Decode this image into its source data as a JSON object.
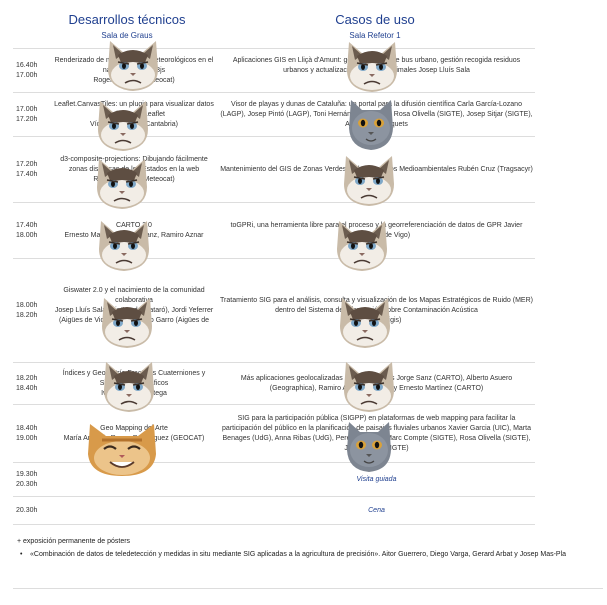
{
  "headers": {
    "left_title": "Desarrollos técnicos",
    "left_sub": "Sala de Graus",
    "right_title": "Casos de uso",
    "right_sub": "Sala Refetor 1"
  },
  "rows": [
    {
      "time": "16.40h\n17.00h",
      "left": "Renderizado de mapas raster meteorológicos en el navegador con D3js\nRoger Veciana (Meteocat)",
      "right": "Aplicaciones GIS en Lliçà d'Amunt: gestión transporte bus urbano, gestión recogida residuos urbanos y actualización censo de animales Josep Lluís Sala\n(Ayto)"
    },
    {
      "time": "17.00h\n17.20h",
      "left": "Leaflet.CanvasTiles: un plugin para visualizar datos masivos con Leaflet\nVíctor Velarde (IHCantabria)",
      "right": "Visor de playas y dunas de Cataluña: un portal para la difusión científica  Carla García-Lozano (LAGP), Josep Pintó (LAGP), Toni Hernández (SIGTE), Rosa Olivella (SIGTE), Josep Sitjar (SIGTE), Alexandre Busquets"
    },
    {
      "time": "17.20h\n17.40h",
      "left": "d3-composite-projections: Dibujando fácilmente zonas dispersas de los Estados en la web\nRoger Veciana (Meteocat)",
      "right": "Mantenimiento del GIS de Zonas Verdes de los Servicios Medioambientales  Rubén Cruz (Tragsacyr)"
    },
    {
      "time": "17.40h\n18.00h",
      "left": "CARTO 2.0\nErnesto Martínez, Jorge Sanz, Ramiro Aznar",
      "right": "toGPRi, una herramienta libre para el proceso y la georreferenciación de datos de GPR   Javier (Universidad de Vigo)"
    },
    {
      "time": "18.00h\n18.20h",
      "left": "Giswater 2.0 y el nacimiento de la comunidad colaborativa\nJosep Lluís Sala (Aigües de Mataró), Jordi Yeferrer (Aigües de Vic), Josep Portero Garro (Aigües de Mataró)",
      "right": "Tratamiento SIG para el análisis, consulta y visualización de los Mapas Estratégicos de Ruido (MER) dentro del Sistema de Información sobre Contaminación Acústica\nJesús (Servigis)"
    },
    {
      "time": "18.20h\n18.40h",
      "left": "Índices y Geometría Fractales Cuaterniones y Sistemas Geográficos\nIván Sánchez Ortega",
      "right": "Más aplicaciones geolocalizadas con geoportales Jorge Sanz (CARTO), Alberto Asuero (Geographica), Ramiro Aznar (CARTO) y Ernesto Martínez (CARTO)"
    },
    {
      "time": "18.40h\n19.00h",
      "left": "Geo Mapping del Arte\nMaría Arias de Reyna Domínguez (GEOCAT)",
      "right": "SIG para la participación pública (SIGPP) en plataformas de web mapping para facilitar la participación del público en la planificación de paisajes fluviales urbanos Xavier Garcia (UIC), Marta Benages (UdG), Anna Ribas (UdG), Pere Vall (UIC), Marc Compte (SIGTE), Rosa Olivella (SIGTE), Josep Sitjar (SIGTE)"
    }
  ],
  "special": [
    {
      "time": "19.30h\n20.30h",
      "label": "Visita guiada"
    },
    {
      "time": "20.30h",
      "label": "Cena"
    }
  ],
  "posters": {
    "heading": "+ exposición permanente de pósters",
    "item": "«Combinación de datos de teledetección y medidas in situ mediante SIG aplicadas a la agricultura de precisión». Aitor Guerrero, Diego Varga, Gerard Arbat y Josep Mas-Pla"
  },
  "cats": [
    {
      "type": "grumpy"
    },
    {
      "type": "grumpy"
    },
    {
      "type": "grumpy"
    },
    {
      "type": "blue"
    },
    {
      "type": "grumpy"
    },
    {
      "type": "grumpy"
    },
    {
      "type": "grumpy"
    },
    {
      "type": "grumpy"
    },
    {
      "type": "grumpy"
    },
    {
      "type": "grumpy"
    },
    {
      "type": "grumpy"
    },
    {
      "type": "grumpy"
    },
    {
      "type": "kitten"
    },
    {
      "type": "blue"
    }
  ]
}
